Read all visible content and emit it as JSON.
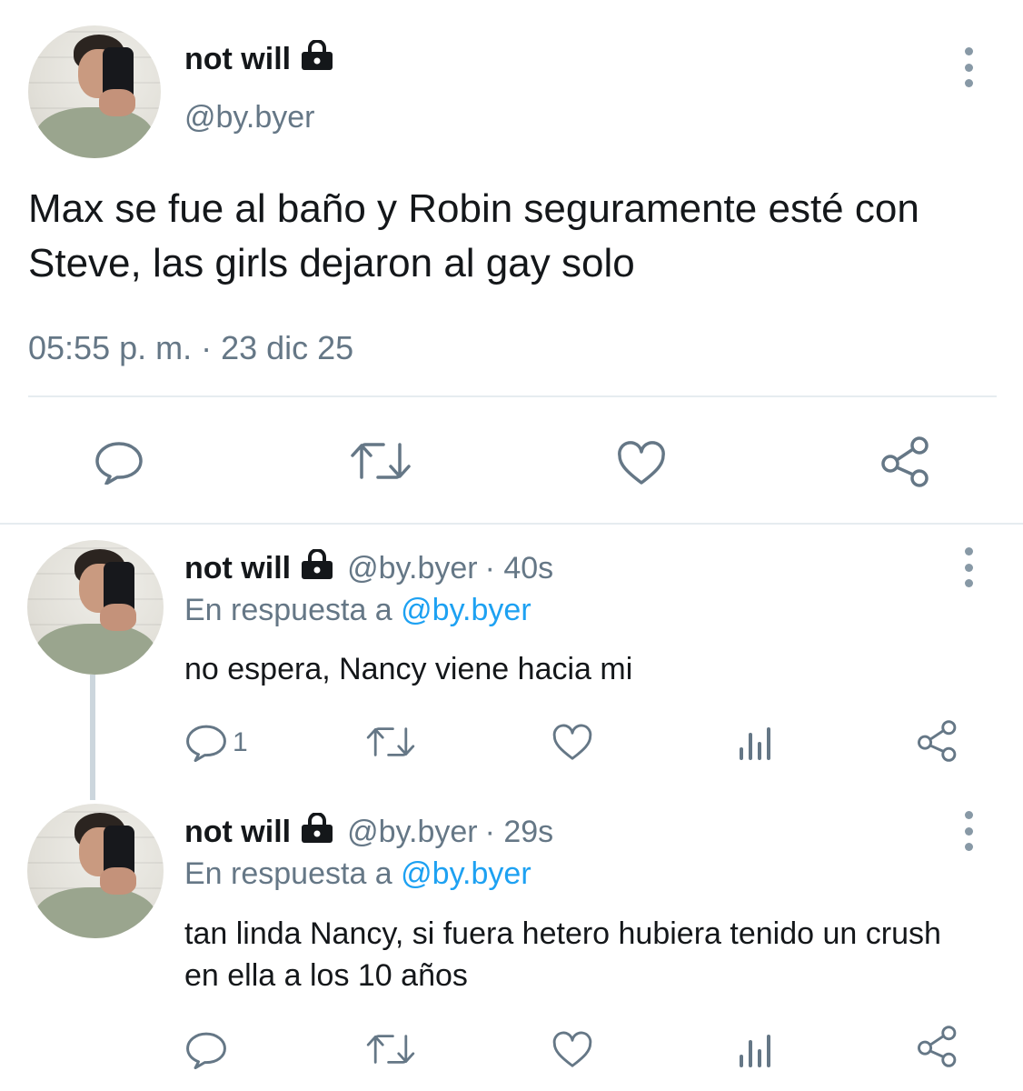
{
  "main_tweet": {
    "name": "not will",
    "handle": "@by.byer",
    "text": "Max se fue al baño y Robin seguramente esté con Steve, las girls dejaron al gay solo",
    "timestamp": "05:55 p. m. · 23 dic 25",
    "icons": [
      "lock-icon",
      "more-icon",
      "reply-icon",
      "retweet-icon",
      "like-icon",
      "share-icon"
    ]
  },
  "replies": [
    {
      "name": "not will",
      "handle": "@by.byer",
      "time": "· 40s",
      "reply_prefix": "En respuesta a",
      "reply_mention": "@by.byer",
      "text": "no espera, Nancy viene hacia mi",
      "reply_count": "1"
    },
    {
      "name": "not will",
      "handle": "@by.byer",
      "time": "· 29s",
      "reply_prefix": "En respuesta a",
      "reply_mention": "@by.byer",
      "text": "tan linda Nancy, si fuera hetero hubiera tenido un crush en ella a los 10 años",
      "reply_count": ""
    }
  ],
  "colors": {
    "text": "#14171a",
    "secondary": "#657786",
    "link": "#1da1f2",
    "icon": "#657786",
    "divider": "#e6ecf0"
  }
}
